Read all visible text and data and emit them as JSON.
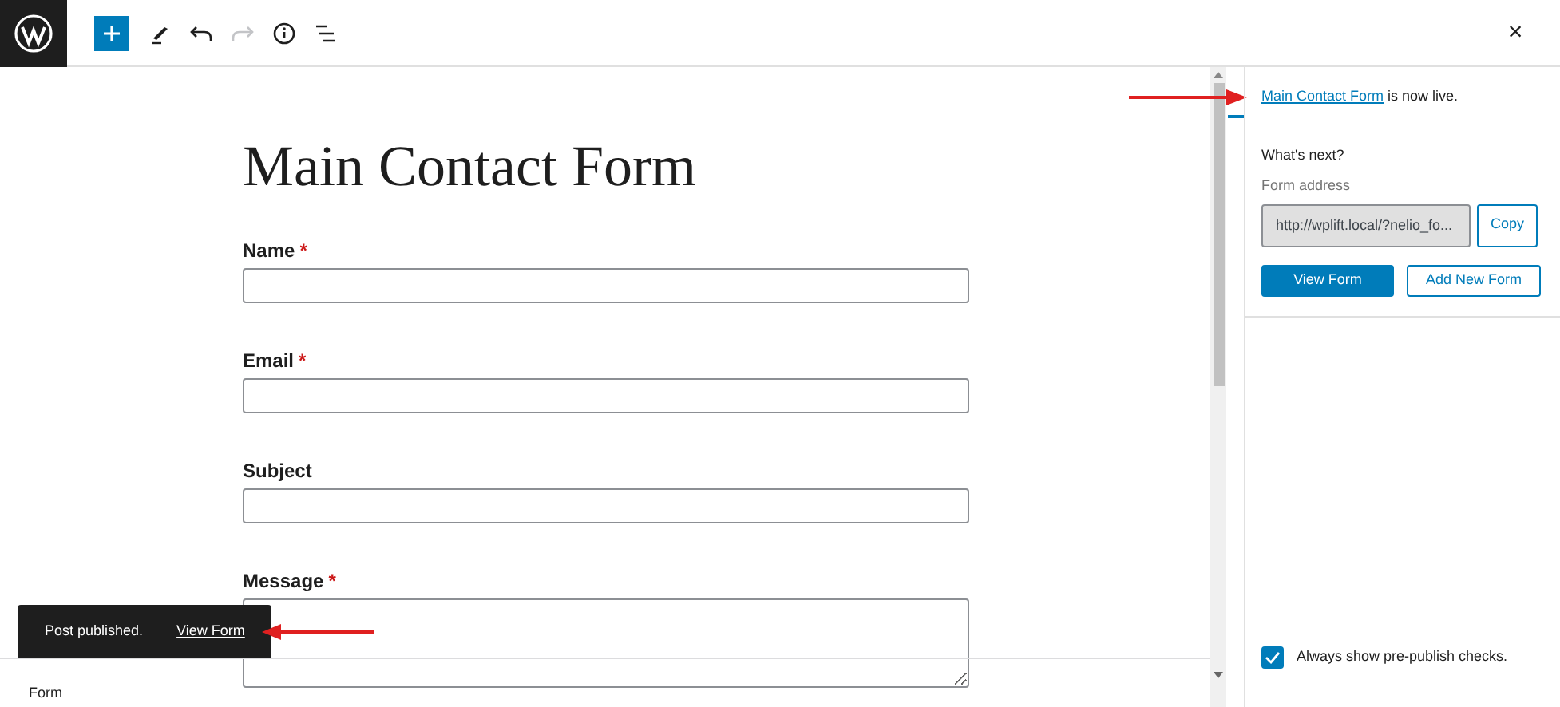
{
  "toolbar": {
    "close": "×"
  },
  "editor": {
    "title": "Main Contact Form",
    "fields": [
      {
        "label": "Name",
        "marker": "*",
        "kind": "input"
      },
      {
        "label": "Email",
        "marker": "*",
        "kind": "input"
      },
      {
        "label": "Subject",
        "kind": "input"
      },
      {
        "label": "Message",
        "marker": "*",
        "kind": "textarea"
      }
    ]
  },
  "snackbar": {
    "message": "Post published.",
    "action": "View Form"
  },
  "breadcrumb": "Form",
  "panel": {
    "link": "Main Contact Form",
    "live_text": " is now live.",
    "heading": "What's next?",
    "address_label": "Form address",
    "address_value": "http://wplift.local/?nelio_fo...",
    "copy": "Copy",
    "view": "View Form",
    "add_new": "Add New Form"
  },
  "prepublish": {
    "label": "Always show pre-publish checks.",
    "checked": true
  }
}
